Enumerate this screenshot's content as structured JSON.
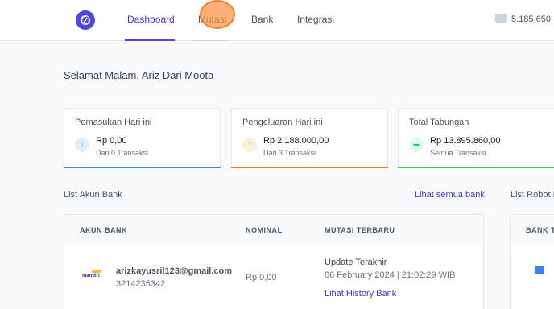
{
  "nav": {
    "items": [
      {
        "label": "Dashboard",
        "active": true
      },
      {
        "label": "Mutasi",
        "active": false
      },
      {
        "label": "Bank",
        "active": false
      },
      {
        "label": "Integrasi",
        "active": false
      }
    ],
    "balance": "5.185.650"
  },
  "greeting": "Selamat Malam, Ariz Dari Moota",
  "stats": [
    {
      "title": "Pemasukan Hari ini",
      "icon": "arrow-down-icon",
      "glyph": "↓",
      "value": "Rp 0,00",
      "sub": "Dari 0 Transaksi",
      "color": "#3b82f6"
    },
    {
      "title": "Pengeluaran Hari ini",
      "icon": "arrow-up-icon",
      "glyph": "↑",
      "value": "Rp 2.188.000,00",
      "sub": "Dari 3 Transaksi",
      "color": "#f97316"
    },
    {
      "title": "Total Tabungan",
      "icon": "wallet-icon",
      "glyph": "▬",
      "value": "Rp 13.895.860,00",
      "sub": "Semua Transaksi",
      "color": "#22c55e"
    }
  ],
  "bank_list": {
    "title": "List Akun Bank",
    "link": "Lihat semua bank",
    "headers": [
      "AKUN BANK",
      "NOMINAL",
      "MUTASI TERBARU"
    ],
    "rows": [
      {
        "bank": "mandiri",
        "email": "arizkayusril123@gmail.com",
        "account": "3214235342",
        "nominal": "Rp 0,00",
        "update_label": "Update Terakhir",
        "update_time": "06 February 2024 | 21:02:29 WIB",
        "history_link": "Lihat History Bank"
      }
    ]
  },
  "robot_list": {
    "title": "List Robot B",
    "header": "BANK T"
  }
}
